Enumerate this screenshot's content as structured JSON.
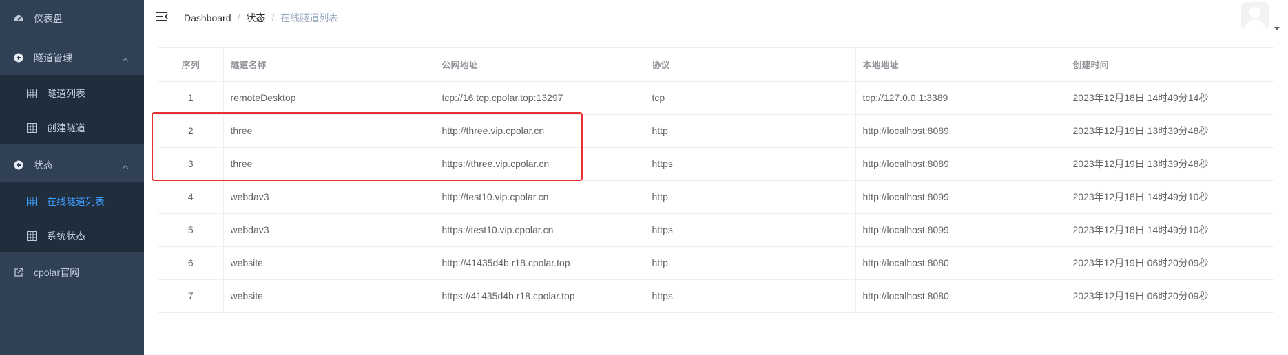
{
  "sidebar": {
    "items": [
      {
        "label": "仪表盘",
        "icon": "dashboard-icon"
      },
      {
        "label": "隧道管理",
        "icon": "tunnel-icon",
        "expanded": true,
        "children": [
          {
            "label": "隧道列表",
            "icon": "grid-icon"
          },
          {
            "label": "创建隧道",
            "icon": "grid-icon"
          }
        ]
      },
      {
        "label": "状态",
        "icon": "status-icon",
        "expanded": true,
        "children": [
          {
            "label": "在线隧道列表",
            "icon": "grid-icon",
            "active": true
          },
          {
            "label": "系统状态",
            "icon": "grid-icon"
          }
        ]
      },
      {
        "label": "cpolar官网",
        "icon": "external-link-icon"
      }
    ],
    "active_color": "#409eff"
  },
  "breadcrumb": [
    "Dashboard",
    "状态",
    "在线隧道列表"
  ],
  "breadcrumb_separator": "/",
  "table": {
    "columns": [
      "序列",
      "隧道名称",
      "公网地址",
      "协议",
      "本地地址",
      "创建时间"
    ],
    "rows": [
      [
        "1",
        "remoteDesktop",
        "tcp://16.tcp.cpolar.top:13297",
        "tcp",
        "tcp://127.0.0.1:3389",
        "2023年12月18日 14时49分14秒"
      ],
      [
        "2",
        "three",
        "http://three.vip.cpolar.cn",
        "http",
        "http://localhost:8089",
        "2023年12月19日 13时39分48秒"
      ],
      [
        "3",
        "three",
        "https://three.vip.cpolar.cn",
        "https",
        "http://localhost:8089",
        "2023年12月19日 13时39分48秒"
      ],
      [
        "4",
        "webdav3",
        "http://test10.vip.cpolar.cn",
        "http",
        "http://localhost:8099",
        "2023年12月18日 14时49分10秒"
      ],
      [
        "5",
        "webdav3",
        "https://test10.vip.cpolar.cn",
        "https",
        "http://localhost:8099",
        "2023年12月18日 14时49分10秒"
      ],
      [
        "6",
        "website",
        "http://41435d4b.r18.cpolar.top",
        "http",
        "http://localhost:8080",
        "2023年12月19日 06时20分09秒"
      ],
      [
        "7",
        "website",
        "https://41435d4b.r18.cpolar.top",
        "https",
        "http://localhost:8080",
        "2023年12月19日 06时20分09秒"
      ]
    ],
    "highlighted_rows": [
      2,
      3
    ],
    "highlight_color": "#e83030"
  }
}
